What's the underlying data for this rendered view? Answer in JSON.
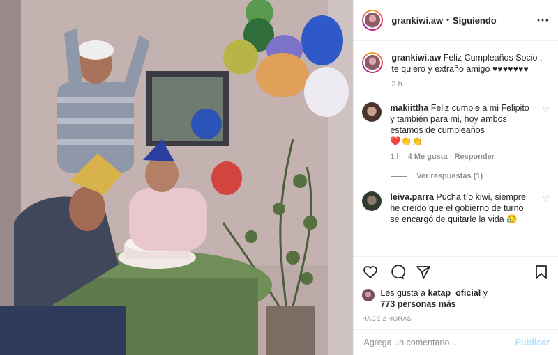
{
  "post": {
    "username": "grankiwi.aw",
    "separator": "•",
    "follow_status": "Siguiendo",
    "more_icon": "ellipsis-icon"
  },
  "caption": {
    "username": "grankiwi.aw",
    "text": "Feliz Cumpleaños Socio , te quiero y extraño amigo ♥♥♥♥♥♥♥",
    "time": "2 h"
  },
  "comments": [
    {
      "username": "makiittha",
      "text": "Feliz cumple a mi Felipito y también para mi, hoy ambos estamos de cumpleaños",
      "emoji": "❤️👏👏",
      "time": "1 h",
      "likes": "4 Me gusta",
      "reply": "Responder",
      "view_replies": "Ver respuestas (1)"
    },
    {
      "username": "leiva.parra",
      "text": "Pucha tío kiwi, siempre he creído que el gobierno de turno se encargó de quitarle la vida",
      "emoji": "😥"
    }
  ],
  "likes_line": {
    "prefix": "Les gusta a",
    "user": "katap_oficial",
    "suffix": "y",
    "count": "773 personas más"
  },
  "timestamp": "HACE 2 HORAS",
  "add_comment": {
    "placeholder": "Agrega un comentario...",
    "publish": "Publicar"
  },
  "colors": {
    "publish_disabled": "#b2dffc",
    "secondary_text": "#8e8e8e",
    "divider": "#efefef"
  }
}
